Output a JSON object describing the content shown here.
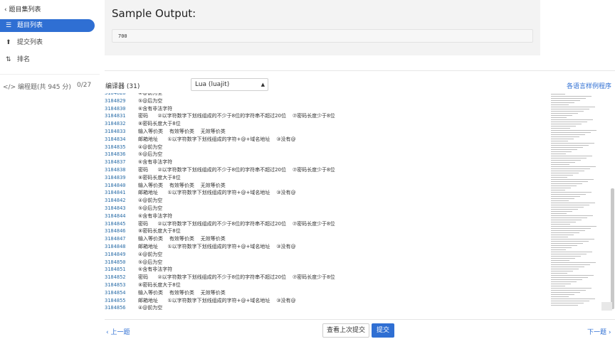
{
  "sidebar": {
    "back_label": "题目集列表",
    "items": [
      {
        "icon": "list-icon",
        "glyph": "☰",
        "label": "题目列表",
        "active": true
      },
      {
        "icon": "upload-icon",
        "glyph": "⬆",
        "label": "提交列表",
        "active": false
      },
      {
        "icon": "sort-icon",
        "glyph": "⇅",
        "label": "排名",
        "active": false
      }
    ],
    "section_label": "编程题(共 945 分)",
    "section_count": "0/27"
  },
  "sample": {
    "title": "Sample Output:",
    "value": "700"
  },
  "compiler": {
    "label": "编译器 (31)",
    "selected": "Lua (luajit)",
    "samples_link": "各语言样例程序"
  },
  "editor": {
    "lines": [
      {
        "n": "3184828",
        "t": "④@前为空"
      },
      {
        "n": "3184829",
        "t": "⑤@后为空"
      },
      {
        "n": "3184830",
        "t": "⑥含有非法字符"
      },
      {
        "n": "3184831",
        "t": "密码      ②以字符数字下划线组成的不少于8位的字符串不超过20位    ⑦密码长度少于8位"
      },
      {
        "n": "3184832",
        "t": "⑧密码长度大于8位"
      },
      {
        "n": "3184833",
        "t": "输入等价类    有效等价类    无效等价类"
      },
      {
        "n": "3184834",
        "t": "邮箱地址      ①以字符数字下划线组成的字符+@+域名地址    ③没有@"
      },
      {
        "n": "3184835",
        "t": "④@前为空"
      },
      {
        "n": "3184836",
        "t": "⑤@后为空"
      },
      {
        "n": "3184837",
        "t": "⑥含有非法字符"
      },
      {
        "n": "3184838",
        "t": "密码      ②以字符数字下划线组成的不少于8位的字符串不超过20位    ⑦密码长度少于8位"
      },
      {
        "n": "3184839",
        "t": "⑧密码长度大于8位"
      },
      {
        "n": "3184840",
        "t": "输入等价类    有效等价类    无效等价类"
      },
      {
        "n": "3184841",
        "t": "邮箱地址      ①以字符数字下划线组成的字符+@+域名地址    ③没有@"
      },
      {
        "n": "3184842",
        "t": "④@前为空"
      },
      {
        "n": "3184843",
        "t": "⑤@后为空"
      },
      {
        "n": "3184844",
        "t": "⑥含有非法字符"
      },
      {
        "n": "3184845",
        "t": "密码      ②以字符数字下划线组成的不少于8位的字符串不超过20位    ⑦密码长度少于8位"
      },
      {
        "n": "3184846",
        "t": "⑧密码长度大于8位"
      },
      {
        "n": "3184847",
        "t": "输入等价类    有效等价类    无效等价类"
      },
      {
        "n": "3184848",
        "t": "邮箱地址      ①以字符数字下划线组成的字符+@+域名地址    ③没有@"
      },
      {
        "n": "3184849",
        "t": "④@前为空"
      },
      {
        "n": "3184850",
        "t": "⑤@后为空"
      },
      {
        "n": "3184851",
        "t": "⑥含有非法字符"
      },
      {
        "n": "3184852",
        "t": "密码      ②以字符数字下划线组成的不少于8位的字符串不超过20位    ⑦密码长度少于8位"
      },
      {
        "n": "3184853",
        "t": "⑧密码长度大于8位"
      },
      {
        "n": "3184854",
        "t": "输入等价类    有效等价类    无效等价类"
      },
      {
        "n": "3184855",
        "t": "邮箱地址      ①以字符数字下划线组成的字符+@+域名地址    ③没有@"
      },
      {
        "n": "3184856",
        "t": "④@前为空"
      }
    ]
  },
  "footer": {
    "prev_label": "上一题",
    "view_last_label": "查看上次提交",
    "submit_label": "提交",
    "next_label": "下一题"
  },
  "colors": {
    "accent": "#2f6fd3",
    "line_number": "#2c6ea8"
  }
}
